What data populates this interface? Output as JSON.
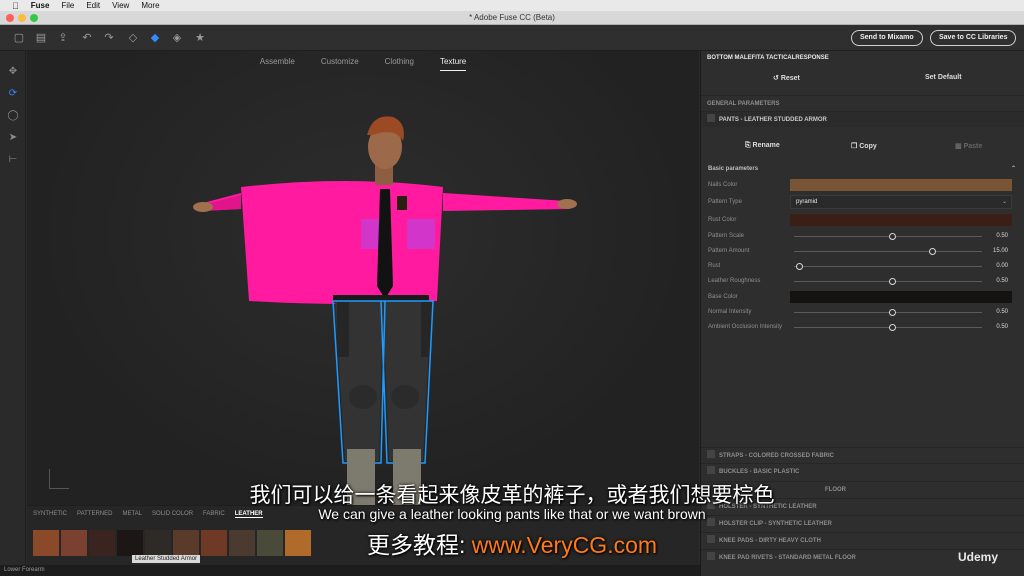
{
  "menubar": {
    "apple": "",
    "app": "Fuse",
    "items": [
      "File",
      "Edit",
      "View",
      "More"
    ]
  },
  "window": {
    "title": "* Adobe Fuse CC (Beta)"
  },
  "toolbar": {
    "send_mixamo": "Send to Mixamo",
    "save_libraries": "Save to CC Libraries"
  },
  "tabs": [
    "Assemble",
    "Customize",
    "Clothing",
    "Texture"
  ],
  "materials": {
    "tabs": [
      "SYNTHETIC",
      "PATTERNED",
      "METAL",
      "SOLID COLOR",
      "FABRIC",
      "LEATHER"
    ],
    "tooltip": "Leather Studded Armor",
    "swatch_colors": [
      "#8a4a2a",
      "#7a4030",
      "#3a2420",
      "#1c1714",
      "#2e2a26",
      "#5a3a28",
      "#6e3a26",
      "#4a3a30",
      "#4a4a3a",
      "#b06a2a"
    ]
  },
  "status": "Lower Forearm",
  "panel": {
    "title": "BOTTOM MALEFITA TACTICALRESPONSE",
    "reset": "Reset",
    "set_default": "Set Default",
    "general": "GENERAL PARAMETERS",
    "material": "PANTS - LEATHER STUDDED ARMOR",
    "rename": "Rename",
    "copy": "Copy",
    "paste": "Paste",
    "basic": "Basic parameters",
    "params": {
      "nails_color": {
        "label": "Nails Color",
        "color": "#7a5535"
      },
      "pattern_type": {
        "label": "Pattern Type",
        "value": "pyramid"
      },
      "rust_color": {
        "label": "Rust Color",
        "color": "#3b1f16"
      },
      "pattern_scale": {
        "label": "Pattern Scale",
        "value": "0.50"
      },
      "pattern_amount": {
        "label": "Pattern Amount",
        "value": "15.00"
      },
      "rust": {
        "label": "Rust",
        "value": "0.00"
      },
      "leather_roughness": {
        "label": "Leather Roughness",
        "value": "0.50"
      },
      "base_color": {
        "label": "Base Color",
        "color": "#151212"
      },
      "normal_intensity": {
        "label": "Normal Intensity",
        "value": "0.50"
      },
      "ao_intensity": {
        "label": "Ambient Occlusion Intensity",
        "value": "0.50"
      }
    },
    "sections": [
      "STRAPS - COLORED CROSSED FABRIC",
      "BUCKLES - BASIC PLASTIC",
      "FLOOR",
      "HOLSTER - SYNTHETIC LEATHER",
      "HOLSTER CLIP - SYNTHETIC LEATHER",
      "KNEE PADS - DIRTY HEAVY CLOTH",
      "KNEE PAD RIVETS - STANDARD METAL FLOOR"
    ]
  },
  "subtitles": {
    "cn": "我们可以给一条看起来像皮革的裤子，或者我们想要棕色",
    "en": "We can give a leather looking pants like that or we want brown",
    "promo_prefix": "更多教程: ",
    "promo_url": "www.VeryCG.com"
  },
  "watermark": "Udemy",
  "colors": {
    "shirt": "#ff1aa0",
    "selection": "#1e9bff"
  }
}
